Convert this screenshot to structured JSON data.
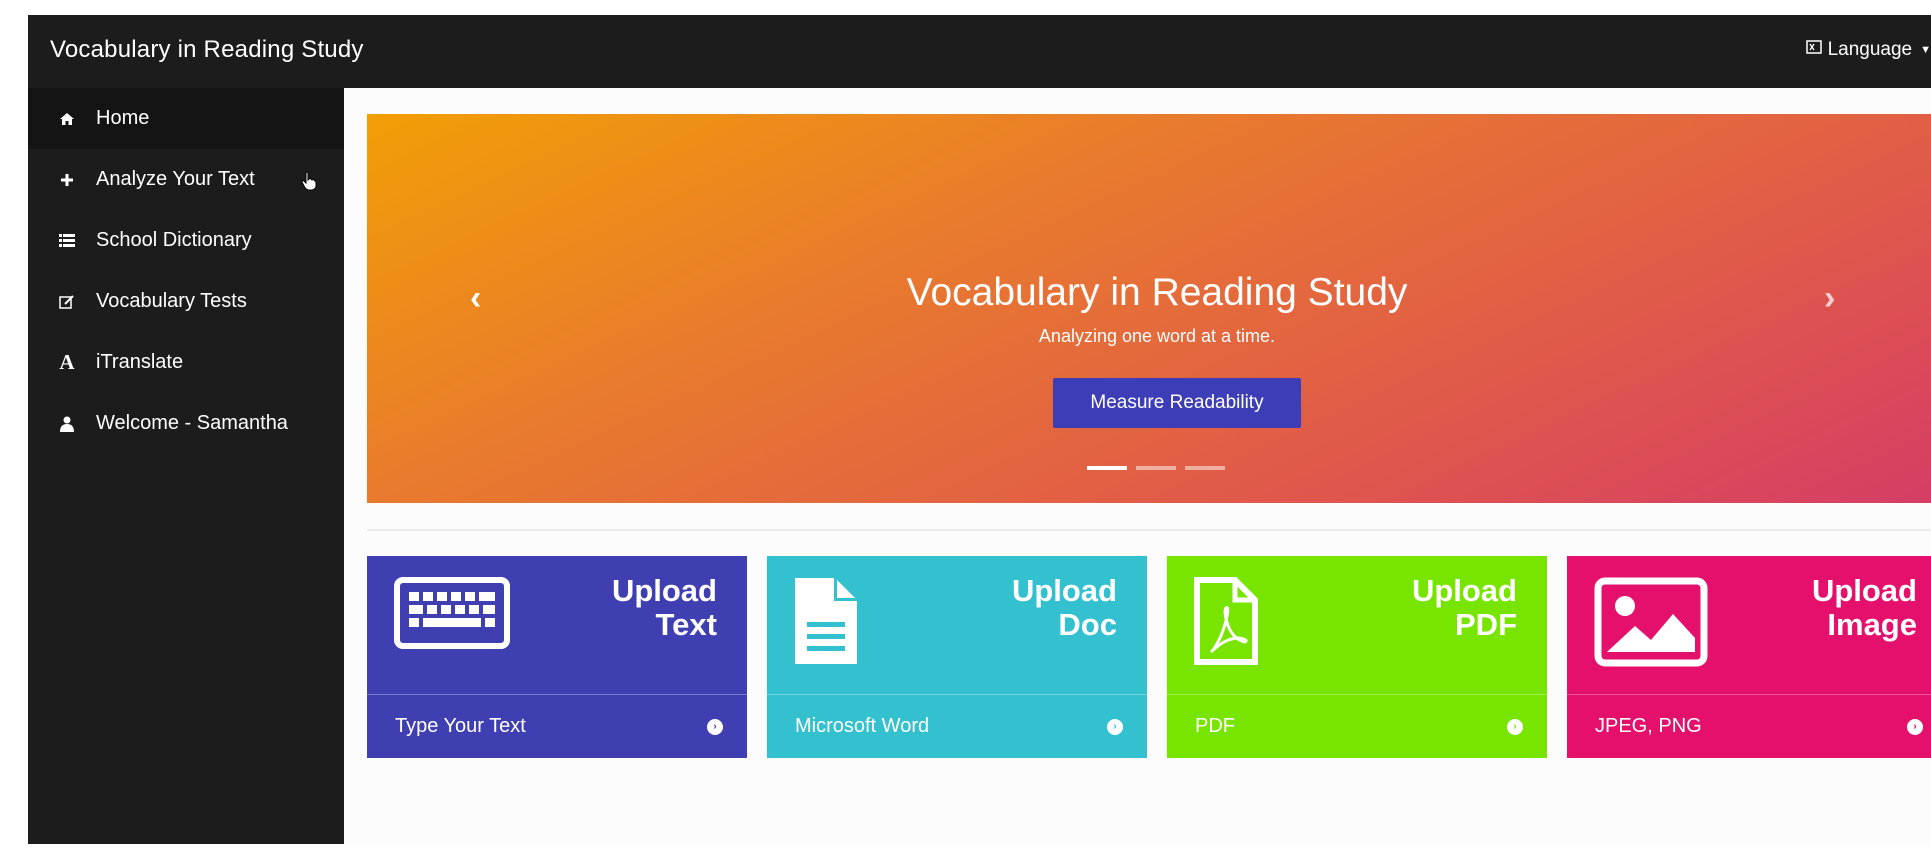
{
  "header": {
    "brand": "Vocabulary in Reading Study",
    "language_label": "Language"
  },
  "sidebar": {
    "items": [
      {
        "label": "Home",
        "icon": "home-icon"
      },
      {
        "label": "Analyze Your Text",
        "icon": "plus-icon"
      },
      {
        "label": "School Dictionary",
        "icon": "list-icon"
      },
      {
        "label": "Vocabulary Tests",
        "icon": "edit-icon"
      },
      {
        "label": "iTranslate",
        "icon": "font-icon"
      },
      {
        "label": "Welcome - Samantha",
        "icon": "user-icon"
      }
    ]
  },
  "carousel": {
    "title": "Vocabulary in Reading Study",
    "subtitle": "Analyzing one word at a time.",
    "button_label": "Measure Readability",
    "active_slide": 1,
    "slide_count": 3
  },
  "cards": [
    {
      "title_line1": "Upload",
      "title_line2": "Text",
      "footer": "Type Your Text",
      "icon": "keyboard-icon",
      "color": "#3f3fb2"
    },
    {
      "title_line1": "Upload",
      "title_line2": "Doc",
      "footer": "Microsoft Word",
      "icon": "document-icon",
      "color": "#34c1cf"
    },
    {
      "title_line1": "Upload",
      "title_line2": "PDF",
      "footer": "PDF",
      "icon": "pdf-icon",
      "color": "#77e500"
    },
    {
      "title_line1": "Upload",
      "title_line2": "Image",
      "footer": "JPEG, PNG",
      "icon": "image-icon",
      "color": "#e4106b"
    }
  ],
  "colors": {
    "topbar": "#1c1c1c",
    "button": "#3d3db7"
  }
}
